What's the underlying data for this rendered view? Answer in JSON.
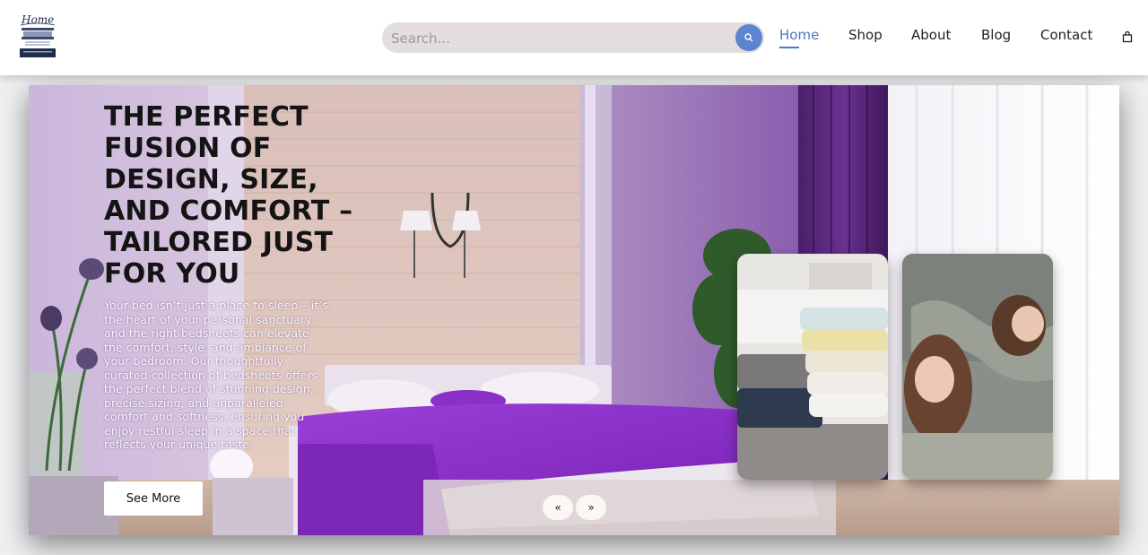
{
  "brand": {
    "logo_text": "Home",
    "logo_icon": "bed-logo-icon"
  },
  "search": {
    "placeholder": "Search...",
    "icon": "search-icon"
  },
  "nav": {
    "items": [
      {
        "label": "Home",
        "active": true
      },
      {
        "label": "Shop",
        "active": false
      },
      {
        "label": "About",
        "active": false
      },
      {
        "label": "Blog",
        "active": false
      },
      {
        "label": "Contact",
        "active": false
      }
    ],
    "cart_icon": "shopping-bag-icon"
  },
  "hero": {
    "title": "THE PERFECT FUSION OF DESIGN, SIZE, AND COMFORT – TAILORED JUST FOR YOU",
    "description": "Your bed isn’t just a place to sleep – it’s the heart of your personal sanctuary, and the right bedsheets can elevate the comfort, style, and ambiance of your bedroom. Our thoughtfully curated collection of bedsheets offers the perfect blend of stunning design, precise sizing, and unparalleled comfort and softness, ensuring you enjoy restful sleep in a space that reflects your unique taste.",
    "cta_label": "See More",
    "prev_label": "«",
    "next_label": "»"
  },
  "colors": {
    "accent": "#4d78c0",
    "search_button": "#5b86cf",
    "search_bg": "#e3dedd",
    "bedspread": "#8a2fc7"
  }
}
